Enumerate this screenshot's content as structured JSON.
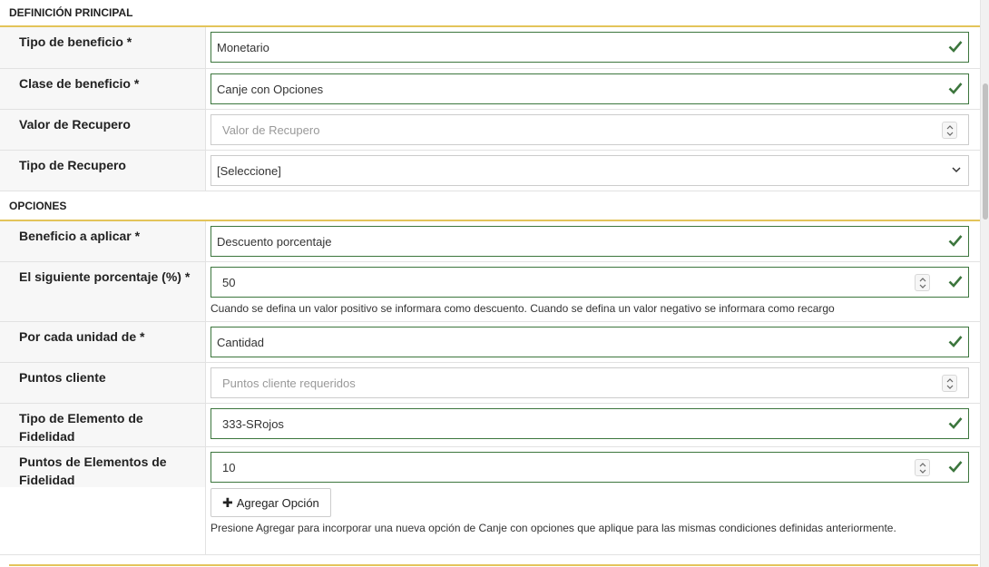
{
  "sections": {
    "principal": "DEFINICIÓN PRINCIPAL",
    "opciones": "OPCIONES"
  },
  "fields": {
    "tipo_beneficio": {
      "label": "Tipo de beneficio *",
      "value": "Monetario"
    },
    "clase_beneficio": {
      "label": "Clase de beneficio *",
      "value": "Canje con Opciones"
    },
    "valor_recupero": {
      "label": "Valor de Recupero",
      "placeholder": "Valor de Recupero"
    },
    "tipo_recupero": {
      "label": "Tipo de Recupero",
      "value": "[Seleccione]"
    },
    "beneficio_aplicar": {
      "label": "Beneficio a aplicar *",
      "value": "Descuento porcentaje"
    },
    "porcentaje": {
      "label": "El siguiente porcentaje (%) *",
      "value": "50",
      "help": "Cuando se defina un valor positivo se informara como descuento. Cuando se defina un valor negativo se informara como recargo"
    },
    "por_cada_unidad": {
      "label": "Por cada unidad de *",
      "value": "Cantidad"
    },
    "puntos_cliente": {
      "label": "Puntos cliente",
      "placeholder": "Puntos cliente requeridos"
    },
    "tipo_elemento": {
      "label": "Tipo de Elemento de Fidelidad",
      "value": "333-SRojos"
    },
    "puntos_elementos": {
      "label": "Puntos de Elementos de Fidelidad",
      "value": "10"
    }
  },
  "actions": {
    "agregar_label": "Agregar Opción",
    "agregar_help": "Presione Agregar para incorporar una nueva opción de Canje con opciones que aplique para las mismas condiciones definidas anteriormente."
  },
  "colors": {
    "accent_line": "#e3c45a",
    "valid_border": "#3c763d",
    "check": "#3c763d"
  },
  "icons": {
    "valid": "check-icon",
    "number": "spinner-icon",
    "select": "chevron-down-icon",
    "add": "plus-icon"
  }
}
